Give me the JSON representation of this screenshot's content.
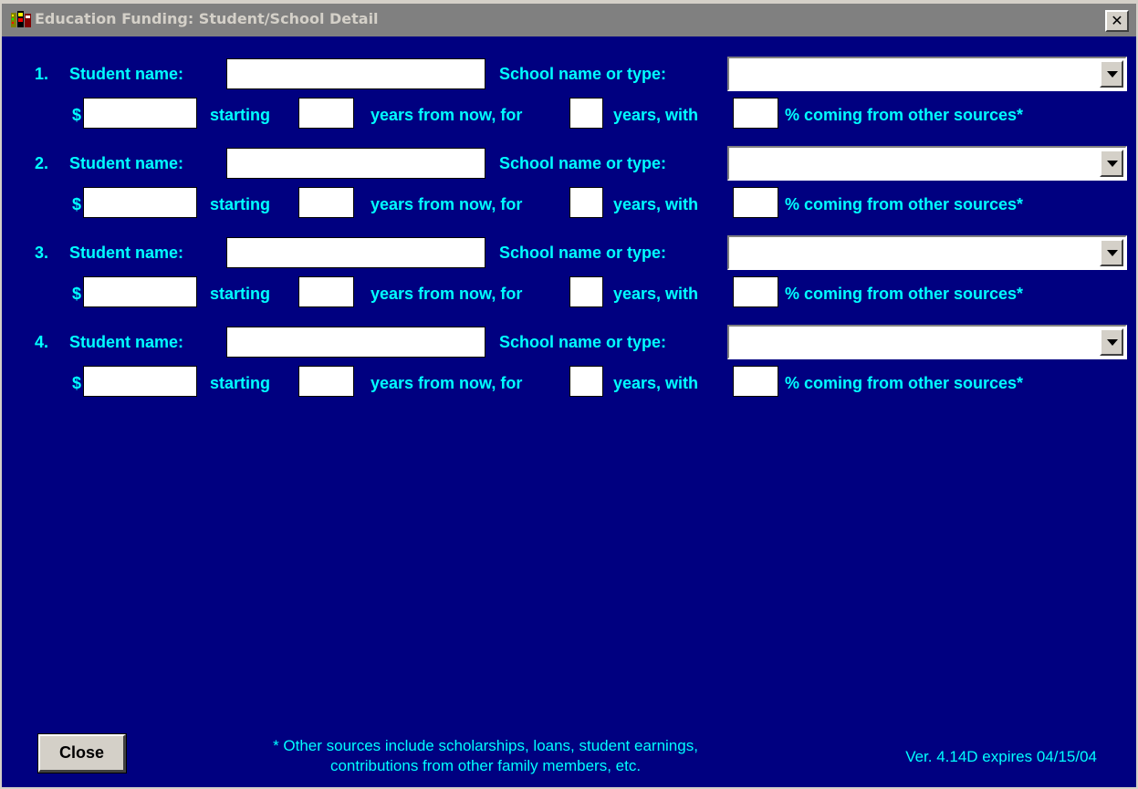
{
  "window": {
    "title": "Education Funding: Student/School Detail",
    "close_glyph": "✕"
  },
  "labels": {
    "student_name": "Student name:",
    "school": "School name or type:",
    "dollar": "$",
    "starting": "starting",
    "years_from_now": "years from now, for",
    "years_with": "years, with",
    "pct_other": "% coming from other sources*"
  },
  "rows": [
    {
      "num": "1.",
      "student_name": "",
      "school": "",
      "amount": "",
      "start_years": "",
      "duration_years": "",
      "pct_other": ""
    },
    {
      "num": "2.",
      "student_name": "",
      "school": "",
      "amount": "",
      "start_years": "",
      "duration_years": "",
      "pct_other": ""
    },
    {
      "num": "3.",
      "student_name": "",
      "school": "",
      "amount": "",
      "start_years": "",
      "duration_years": "",
      "pct_other": ""
    },
    {
      "num": "4.",
      "student_name": "",
      "school": "",
      "amount": "",
      "start_years": "",
      "duration_years": "",
      "pct_other": ""
    }
  ],
  "footer": {
    "close_label": "Close",
    "footnote_line1": "* Other sources include scholarships, loans, student earnings,",
    "footnote_line2": "contributions from other family members, etc.",
    "version": "Ver. 4.14D expires 04/15/04"
  },
  "colors": {
    "background": "#000080",
    "label": "#00ffff",
    "titlebar": "#808080"
  },
  "icons": {
    "app": "app-icon",
    "close": "close-icon",
    "dropdown": "chevron-down-icon"
  }
}
